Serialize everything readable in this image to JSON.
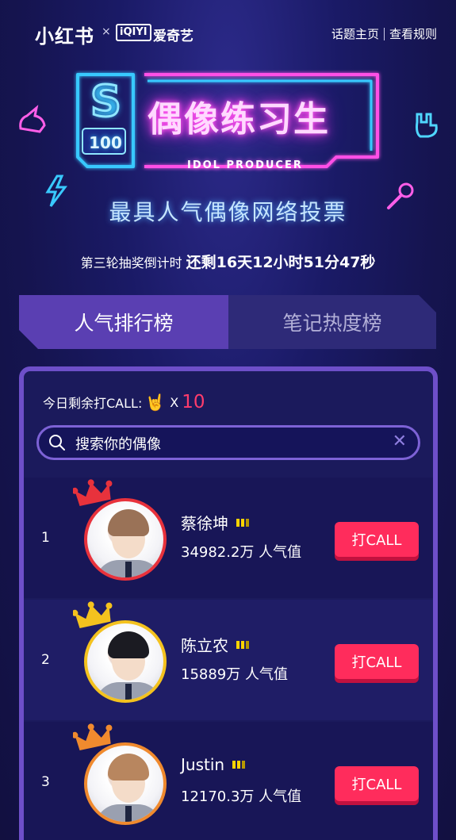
{
  "header": {
    "brand_left": "小红书",
    "brand_x": "×",
    "brand_iqiyi": "iQIYI",
    "brand_aqy": "爱奇艺",
    "link_topic": "话题主页",
    "link_rules": "查看规则"
  },
  "banner": {
    "badge_top": "S",
    "badge_num": "100",
    "title": "偶像练习生",
    "subtitle": "IDOL PRODUCER",
    "headline": "最具人气偶像网络投票"
  },
  "countdown": {
    "label": "第三轮抽奖倒计时",
    "value": "还剩16天12小时51分47秒"
  },
  "tabs": [
    {
      "label": "人气排行榜",
      "active": true
    },
    {
      "label": "笔记热度榜",
      "active": false
    }
  ],
  "call_status": {
    "label": "今日剩余打CALL:",
    "mult": "X",
    "count": "10"
  },
  "search": {
    "placeholder": "搜索你的偶像"
  },
  "ranking": [
    {
      "rank": "1",
      "name": "蔡徐坤",
      "score": "34982.2万 人气值",
      "button": "打CALL",
      "crown_color": "#e8323c",
      "ring_color": "#e8323c",
      "hair_color": "#9a7257"
    },
    {
      "rank": "2",
      "name": "陈立农",
      "score": "15889万 人气值",
      "button": "打CALL",
      "crown_color": "#f4c21e",
      "ring_color": "#f4c21e",
      "hair_color": "#1b1b22"
    },
    {
      "rank": "3",
      "name": "Justin",
      "score": "12170.3万 人气值",
      "button": "打CALL",
      "crown_color": "#f08a2e",
      "ring_color": "#f08a2e",
      "hair_color": "#b8865f"
    }
  ]
}
